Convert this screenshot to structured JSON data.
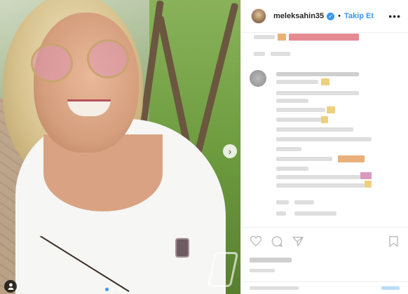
{
  "post": {
    "username": "meleksahin35",
    "verified_icon": "verified-check-icon",
    "separator": "•",
    "follow_label": "Takip Et",
    "more_icon": "more-options-icon",
    "more_glyph": "•••"
  },
  "media": {
    "next_glyph": "›",
    "carousel_count": 3,
    "active_index": 0
  },
  "colors": {
    "accent": "#3897f0",
    "text": "#262626",
    "border": "#efefef"
  }
}
